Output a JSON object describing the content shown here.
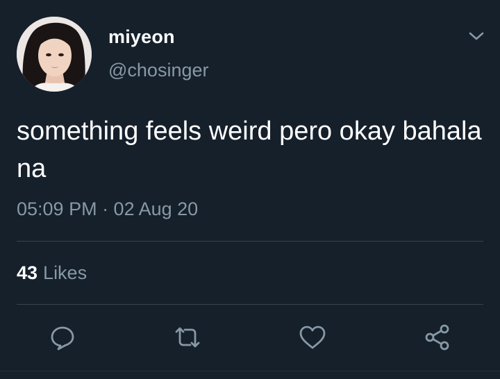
{
  "user": {
    "display_name": "miyeon",
    "handle": "@chosinger"
  },
  "tweet": {
    "text": "something feels weird pero okay bahala na",
    "timestamp": "05:09 PM · 02 Aug 20"
  },
  "stats": {
    "likes_count": "43",
    "likes_label": "Likes"
  },
  "icons": {
    "caret": "chevron-down-icon",
    "reply": "reply-icon",
    "retweet": "retweet-icon",
    "like": "heart-icon",
    "share": "share-icon"
  },
  "colors": {
    "background": "#15202b",
    "primary_text": "#ffffff",
    "secondary_text": "#8899a6",
    "divider": "#38444d"
  }
}
